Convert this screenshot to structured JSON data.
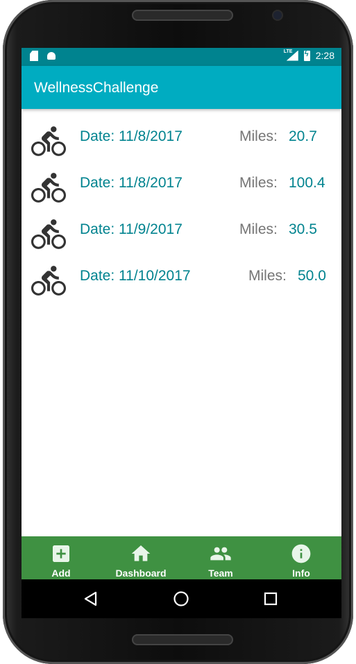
{
  "status_bar": {
    "time": "2:28",
    "network": "LTE",
    "icons": [
      "sd-card-icon",
      "android-icon",
      "signal-icon",
      "battery-charging-icon"
    ]
  },
  "app_bar": {
    "title": "WellnessChallenge"
  },
  "entries": [
    {
      "activity_icon": "bike-icon",
      "date": "Date: 11/8/2017",
      "miles_label": "Miles:",
      "miles_value": "20.7"
    },
    {
      "activity_icon": "bike-icon",
      "date": "Date: 11/8/2017",
      "miles_label": "Miles:",
      "miles_value": "100.4"
    },
    {
      "activity_icon": "bike-icon",
      "date": "Date: 11/9/2017",
      "miles_label": "Miles:",
      "miles_value": "30.5"
    },
    {
      "activity_icon": "bike-icon",
      "date": "Date: 11/10/2017",
      "miles_label": "Miles:",
      "miles_value": "50.0"
    }
  ],
  "bottom_nav": [
    {
      "icon": "add-box-icon",
      "label": "Add"
    },
    {
      "icon": "home-icon",
      "label": "Dashboard"
    },
    {
      "icon": "people-icon",
      "label": "Team"
    },
    {
      "icon": "info-icon",
      "label": "Info"
    }
  ],
  "system_nav": [
    "back-icon",
    "home-circle-icon",
    "recents-icon"
  ],
  "colors": {
    "status_bar": "#00838f",
    "app_bar": "#00acc1",
    "accent_text": "#00838f",
    "secondary_text": "#757575",
    "bottom_nav": "#3f9142"
  }
}
